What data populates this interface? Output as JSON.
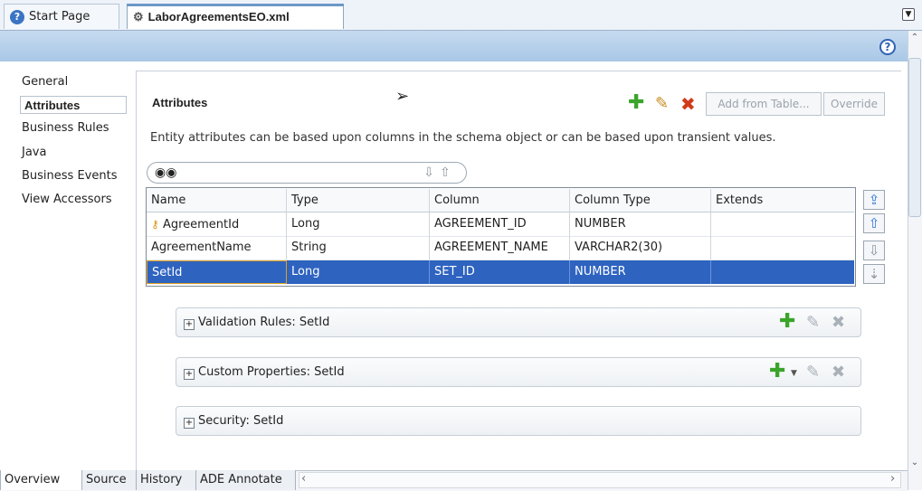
{
  "tabs": {
    "start_page": "Start Page",
    "document": "LaborAgreementsEO.xml"
  },
  "left_nav": {
    "items": [
      {
        "label": "General",
        "selected": false
      },
      {
        "label": "Attributes",
        "selected": true
      },
      {
        "label": "Business Rules",
        "selected": false
      },
      {
        "label": "Java",
        "selected": false
      },
      {
        "label": "Business Events",
        "selected": false
      },
      {
        "label": "View Accessors",
        "selected": false
      }
    ]
  },
  "main": {
    "title": "Attributes",
    "description": "Entity attributes can be based upon columns in the schema object or can be based upon transient values.",
    "toolbar": {
      "add_from_table": "Add from Table...",
      "override": "Override"
    }
  },
  "table": {
    "columns": [
      "Name",
      "Type",
      "Column",
      "Column Type",
      "Extends"
    ],
    "rows": [
      {
        "name": "AgreementId",
        "type": "Long",
        "column": "AGREEMENT_ID",
        "column_type": "NUMBER",
        "extends": "",
        "key": true
      },
      {
        "name": "AgreementName",
        "type": "String",
        "column": "AGREEMENT_NAME",
        "column_type": "VARCHAR2(30)",
        "extends": ""
      },
      {
        "name": "SetId",
        "type": "Long",
        "column": "SET_ID",
        "column_type": "NUMBER",
        "extends": "",
        "selected": true
      }
    ]
  },
  "sections": {
    "validation": "Validation Rules: SetId",
    "custom": "Custom Properties: SetId",
    "security": "Security: SetId"
  },
  "bottom_tabs": [
    "Overview",
    "Source",
    "History",
    "ADE Annotate"
  ],
  "colors": {
    "selection": "#2e63c0",
    "header_band": "#b8d1eb",
    "add_green": "#3aa52a",
    "delete_red": "#d23a1a"
  }
}
